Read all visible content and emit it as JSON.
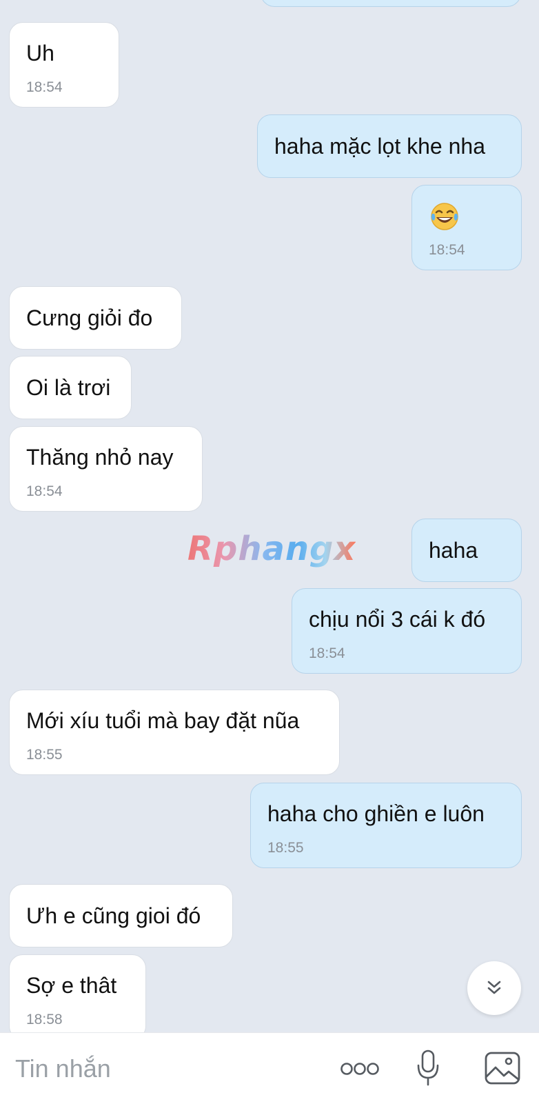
{
  "conversation": {
    "messages": [
      {
        "side": "in",
        "text": "Uh",
        "time": "18:54"
      },
      {
        "side": "out",
        "text": "haha mặc lọt khe nha",
        "time": ""
      },
      {
        "side": "out",
        "text": "",
        "emoji": "face-with-tears-of-joy",
        "time": "18:54"
      },
      {
        "side": "in",
        "text": "Cưng giỏi đo",
        "time": ""
      },
      {
        "side": "in",
        "text": "Oi là trơi",
        "time": ""
      },
      {
        "side": "in",
        "text": "Thăng nhỏ nay",
        "time": "18:54"
      },
      {
        "side": "out",
        "text": "haha",
        "time": ""
      },
      {
        "side": "out",
        "text": "chịu nổi 3 cái k đó",
        "time": "18:54"
      },
      {
        "side": "in",
        "text": "Mới xíu tuổi mà bay đặt nũa",
        "time": "18:55"
      },
      {
        "side": "out",
        "text": "haha cho ghiền e luôn",
        "time": "18:55"
      },
      {
        "side": "in",
        "text": "Ưh e cũng gioi đó",
        "time": ""
      },
      {
        "side": "in",
        "text": "Sợ e thât",
        "time": "18:58"
      }
    ]
  },
  "watermark": {
    "text": "Rphangx"
  },
  "scroll_button": {
    "icon": "double-chevron-down-icon"
  },
  "input_bar": {
    "placeholder": "Tin nhắn",
    "icons": [
      "more-options-icon",
      "microphone-icon",
      "image-icon"
    ]
  },
  "colors": {
    "background": "#e3e8f0",
    "incoming_bubble": "#ffffff",
    "outgoing_bubble": "#d5ecfb",
    "timestamp": "#8a8f96",
    "icon": "#555a60"
  }
}
